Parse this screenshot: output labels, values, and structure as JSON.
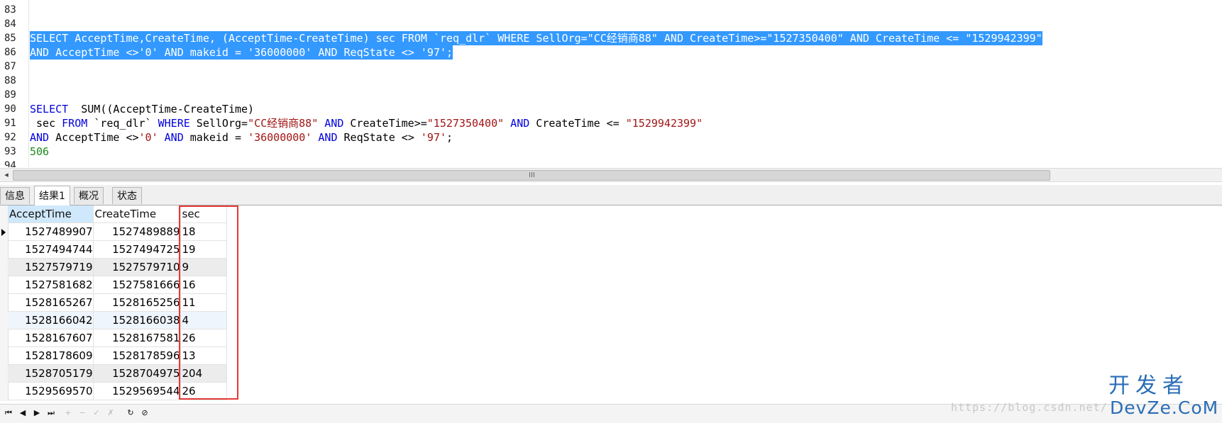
{
  "editor": {
    "line_numbers": [
      "83",
      "84",
      "85",
      "86",
      "87",
      "88",
      "89",
      "90",
      "91",
      "92",
      "93",
      "94"
    ],
    "line85": "SELECT AcceptTime,CreateTime, (AcceptTime-CreateTime) sec FROM `req_dlr` WHERE SellOrg=\"CC经销商88\" AND CreateTime>=\"1527350400\" AND CreateTime <= \"1529942399\"",
    "line86": "AND AcceptTime <>'0' AND makeid = '36000000' AND ReqState <> '97';",
    "line90": {
      "kw": "SELECT",
      "rest": "  SUM((AcceptTime-CreateTime)"
    },
    "line91": {
      "t1": " sec ",
      "kw1": "FROM",
      "t2": " `req_dlr` ",
      "kw2": "WHERE",
      "t3": " SellOrg=",
      "s1": "\"CC经销商88\"",
      "kw3": " AND",
      "t4": " CreateTime>=",
      "s2": "\"1527350400\"",
      "kw4": " AND",
      "t5": " CreateTime <= ",
      "s3": "\"1529942399\""
    },
    "line92": {
      "kw1": "AND",
      "t1": " AcceptTime <>",
      "s1": "'0'",
      "kw2": " AND",
      "t2": " makeid = ",
      "s2": "'36000000'",
      "kw3": " AND",
      "t3": " ReqState <> ",
      "s3": "'97'",
      "t4": ";"
    },
    "line93": "506",
    "scroll_grip": "III"
  },
  "tabs": [
    "信息",
    "结果1",
    "概况",
    "状态"
  ],
  "grid": {
    "columns": [
      "AcceptTime",
      "CreateTime",
      "sec"
    ],
    "rows": [
      [
        "1527489907",
        "1527489889",
        "18"
      ],
      [
        "1527494744",
        "1527494725",
        "19"
      ],
      [
        "1527579719",
        "1527579710",
        "9"
      ],
      [
        "1527581682",
        "1527581666",
        "16"
      ],
      [
        "1528165267",
        "1528165256",
        "11"
      ],
      [
        "1528166042",
        "1528166038",
        "4"
      ],
      [
        "1528167607",
        "1528167581",
        "26"
      ],
      [
        "1528178609",
        "1528178596",
        "13"
      ],
      [
        "1528705179",
        "1528704975",
        "204"
      ],
      [
        "1529569570",
        "1529569544",
        "26"
      ]
    ]
  },
  "navigator": {
    "first": "⏮",
    "prev": "◀",
    "next": "▶",
    "last": "⏭",
    "add": "+",
    "delete": "−",
    "apply": "✓",
    "discard": "✗",
    "refresh": "↻",
    "stop": "⊘"
  },
  "watermark": {
    "url": "https://blog.csdn.net/",
    "cn": "开发者",
    "en": "DevZe.CoM"
  },
  "colors": {
    "selection": "#3399ff",
    "keyword": "#0000dd",
    "string": "#a31515",
    "number": "#1b8a1b",
    "highlight_box": "#e53935"
  }
}
